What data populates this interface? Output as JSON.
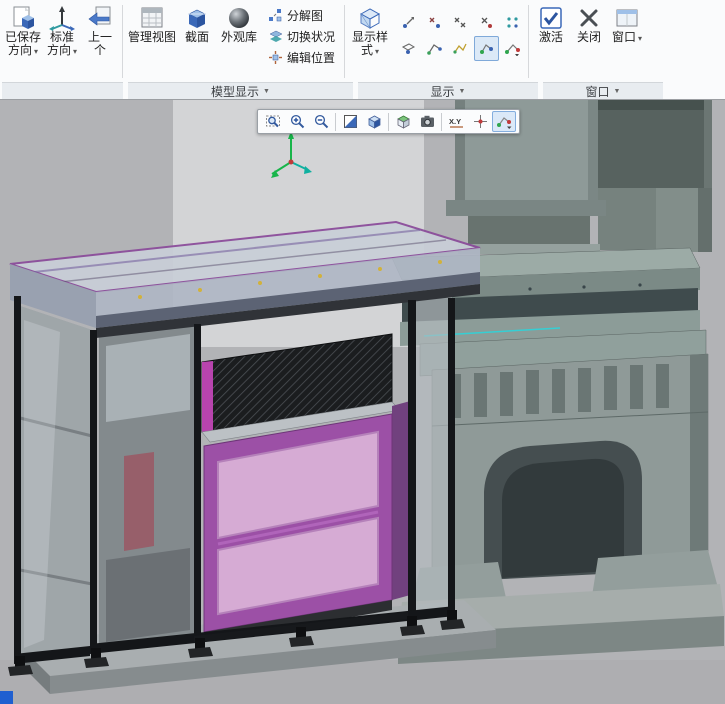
{
  "ribbon": {
    "caret": "▾",
    "group_caret": "▼",
    "orientation": {
      "saved": {
        "line1": "已保存",
        "line2": "方向"
      },
      "standard": {
        "line1": "标准",
        "line2": "方向"
      },
      "previous": {
        "line1": "上一",
        "line2": "个"
      }
    },
    "model_display": {
      "group_label": "模型显示",
      "manage_views": "管理视图",
      "section": "截面",
      "appearance_library": "外观库",
      "exploded_view": "分解图",
      "toggle_state": "切换状况",
      "edit_position": "编辑位置"
    },
    "display": {
      "group_label": "显示",
      "display_style_line1": "显示样",
      "display_style_line2": "式"
    },
    "window_group": {
      "group_label": "窗口",
      "activate": "激活",
      "close": "关闭",
      "window": "窗口"
    }
  },
  "viewport": {
    "toolbar": {
      "measure_label": "X.Y",
      "icons": [
        "fit-view",
        "zoom-in",
        "zoom-out",
        "shaded-view",
        "cube-view",
        "orient-view",
        "snapshot",
        "measure-xy",
        "point-select",
        "route-tool"
      ]
    }
  },
  "colors": {
    "cabinet_purple": "#9c50a6",
    "panel_pink": "#d6abd4",
    "machine_gray": "#8f9a98",
    "accent_magenta": "#b844ae",
    "selection_blue": "#dbe9f8"
  }
}
